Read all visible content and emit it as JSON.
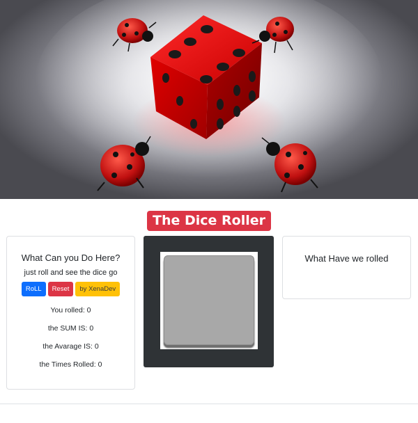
{
  "header": {
    "title": "The Dice Roller",
    "hero_image": "dice-and-ladybugs-illustration"
  },
  "info_card": {
    "heading": "What Can you Do Here?",
    "subtitle": "just roll and see the dice go",
    "buttons": {
      "roll": "RoLL",
      "reset": "Reset",
      "credit": "by XenaDev"
    },
    "stats": {
      "rolled": "You rolled: 0",
      "sum": "the SUM IS: 0",
      "average": "the Avarage IS: 0",
      "times": "the Times Rolled: 0"
    }
  },
  "history_card": {
    "heading": "What Have we rolled"
  },
  "colors": {
    "title_bg": "#dc3545",
    "roll_button": "#0d6efd",
    "reset_button": "#dc3545",
    "credit_button": "#ffc107",
    "dice_panel": "#2f3336",
    "dice_face": "#a8a8a8"
  }
}
